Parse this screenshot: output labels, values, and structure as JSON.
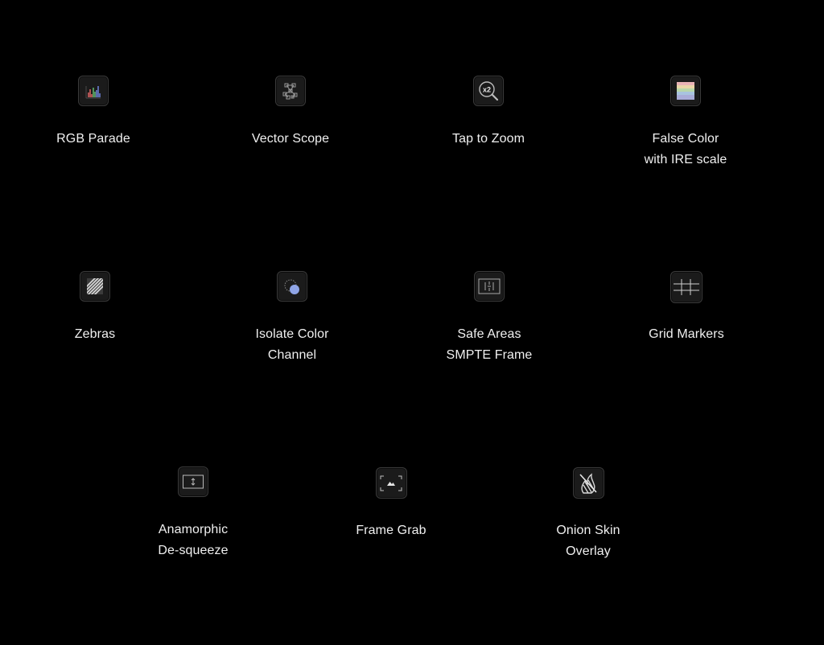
{
  "features": [
    {
      "id": "rgb-parade",
      "icon": "rgb-parade-icon",
      "lines": [
        "RGB Parade"
      ]
    },
    {
      "id": "vector-scope",
      "icon": "vector-scope-icon",
      "lines": [
        "Vector Scope"
      ]
    },
    {
      "id": "tap-to-zoom",
      "icon": "zoom-x2-icon",
      "icon_text": "x2",
      "lines": [
        "Tap to Zoom"
      ]
    },
    {
      "id": "false-color",
      "icon": "false-color-icon",
      "lines": [
        "False Color",
        "with IRE scale"
      ]
    },
    {
      "id": "zebras",
      "icon": "zebra-stripes-icon",
      "lines": [
        "Zebras"
      ]
    },
    {
      "id": "isolate-color",
      "icon": "color-channel-icon",
      "lines": [
        "Isolate Color",
        "Channel"
      ]
    },
    {
      "id": "safe-areas",
      "icon": "safe-area-frame-icon",
      "lines": [
        "Safe Areas",
        "SMPTE Frame"
      ]
    },
    {
      "id": "grid-markers",
      "icon": "grid-icon",
      "lines": [
        "Grid Markers"
      ]
    },
    {
      "id": "anamorphic",
      "icon": "desqueeze-icon",
      "lines": [
        "Anamorphic",
        "De-squeeze"
      ]
    },
    {
      "id": "frame-grab",
      "icon": "frame-grab-icon",
      "lines": [
        "Frame Grab"
      ]
    },
    {
      "id": "onion-skin",
      "icon": "onion-skin-icon",
      "lines": [
        "Onion Skin",
        "Overlay"
      ]
    }
  ],
  "colors": {
    "background": "#000000",
    "tile": "#1b1b1b",
    "tile_border": "#3a3a3a",
    "text": "#f0f0f0",
    "icon_stroke": "#9a9a9a"
  }
}
